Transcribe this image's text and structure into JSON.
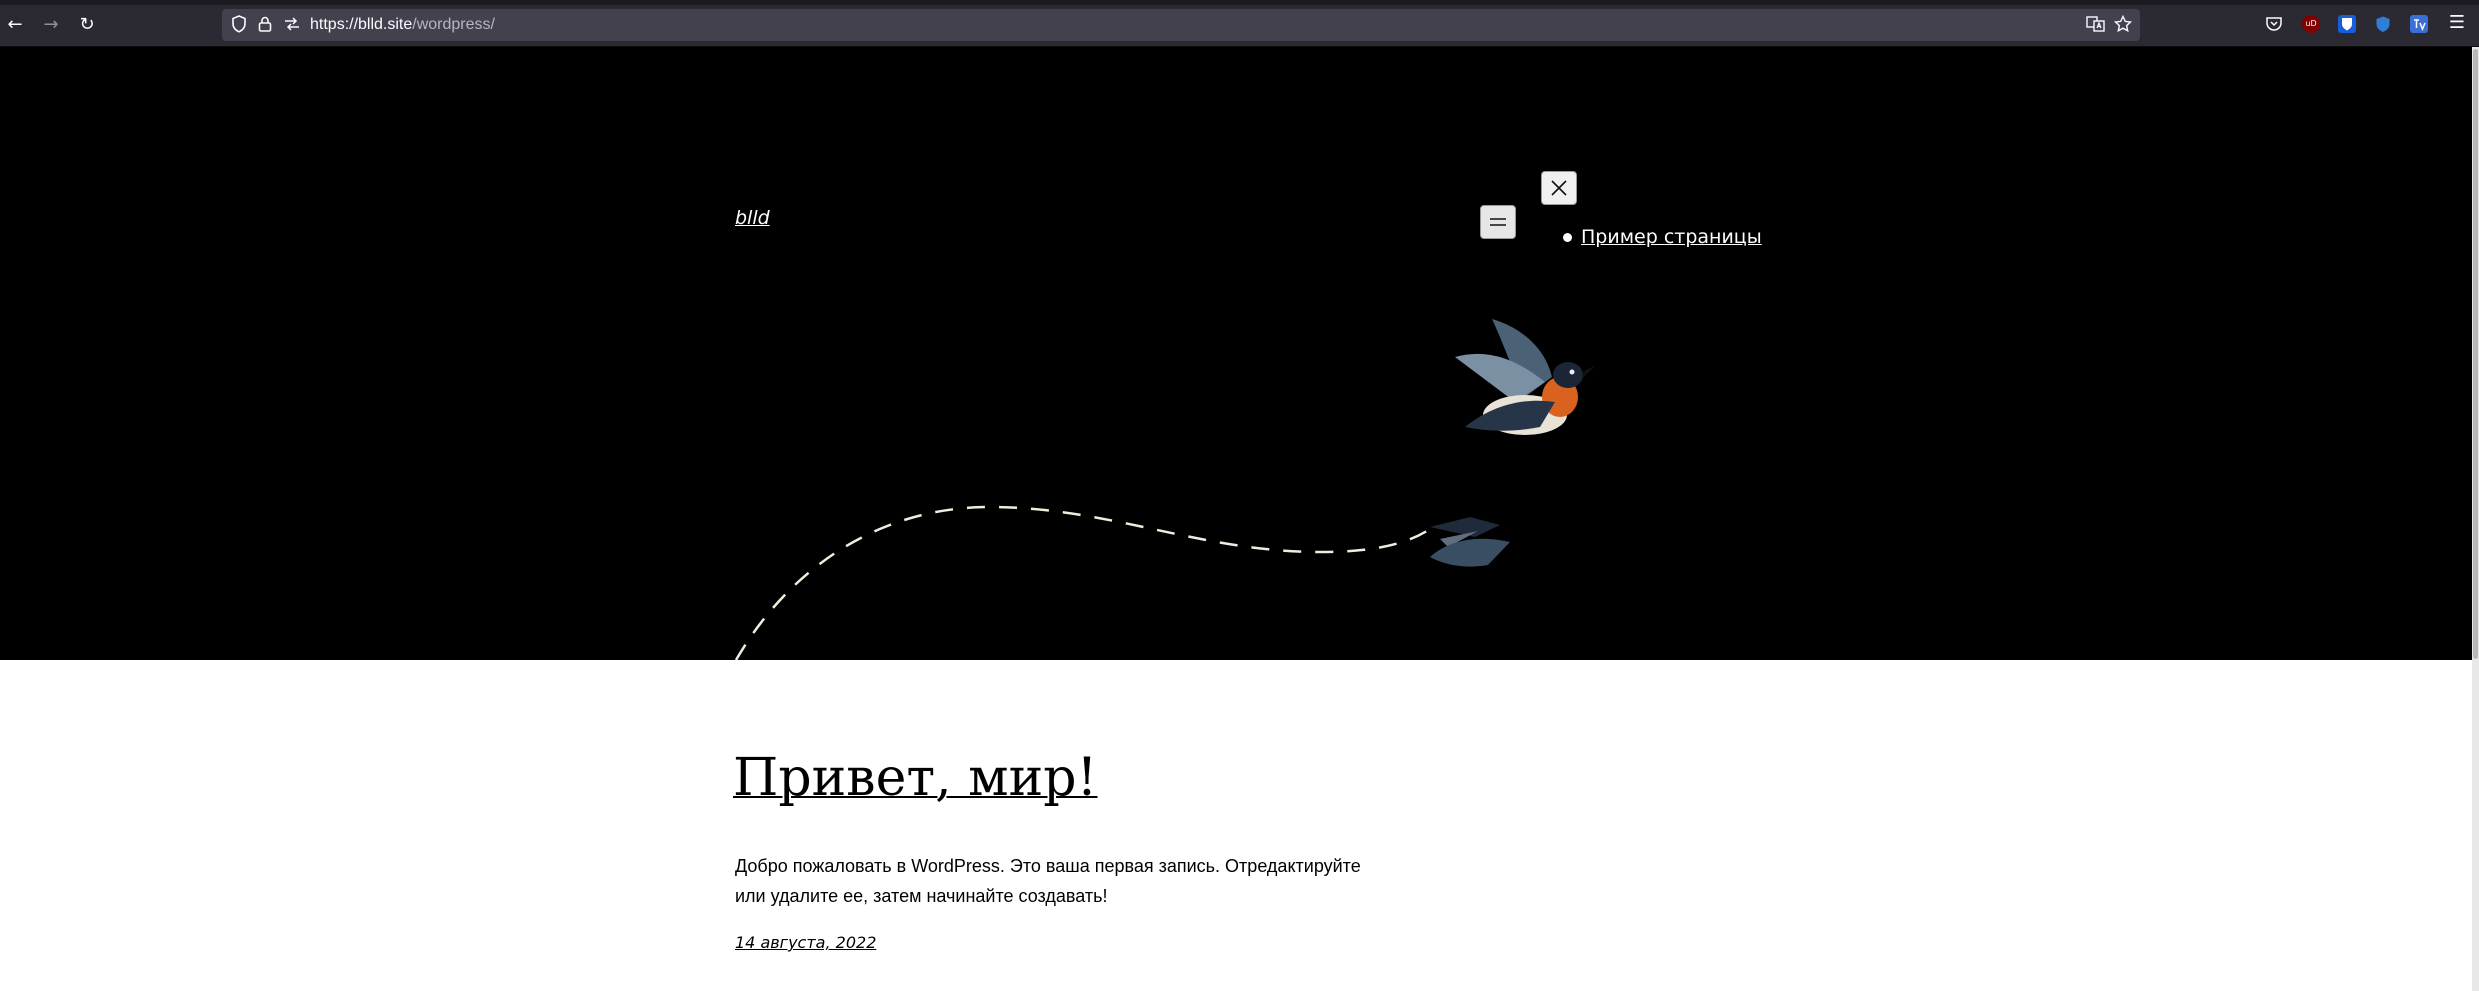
{
  "browser": {
    "url_host": "https://blld.site",
    "url_path": "/wordpress/",
    "icons": {
      "back": "arrow-left-icon",
      "forward": "arrow-right-icon",
      "reload": "reload-icon",
      "shield": "tracking-protection-icon",
      "lock": "lock-icon",
      "permissions": "permissions-icon",
      "translate": "translate-icon",
      "bookmark": "star-icon",
      "pocket": "pocket-icon",
      "menu": "hamburger-menu-icon"
    },
    "extensions": [
      {
        "name": "ublock-origin-icon",
        "label": "uD",
        "color": "#800000"
      },
      {
        "name": "bitwarden-icon",
        "label": "",
        "color": "#175ddc"
      },
      {
        "name": "vpn-shield-icon",
        "label": "",
        "color": "#2f7fd6"
      },
      {
        "name": "translator-extension-icon",
        "label": "",
        "color": "#3b6fd8"
      }
    ]
  },
  "site": {
    "title": "blld",
    "menu_toggle_symbol": "☰",
    "close_symbol": "✕",
    "nav_items": [
      {
        "label": "Пример страницы"
      }
    ]
  },
  "post": {
    "title": "Привет, мир!",
    "body": "Добро пожаловать в WordPress. Это ваша первая запись. Отредактируйте или удалите ее, затем начинайте создавать!",
    "date": "14 августа, 2022"
  }
}
